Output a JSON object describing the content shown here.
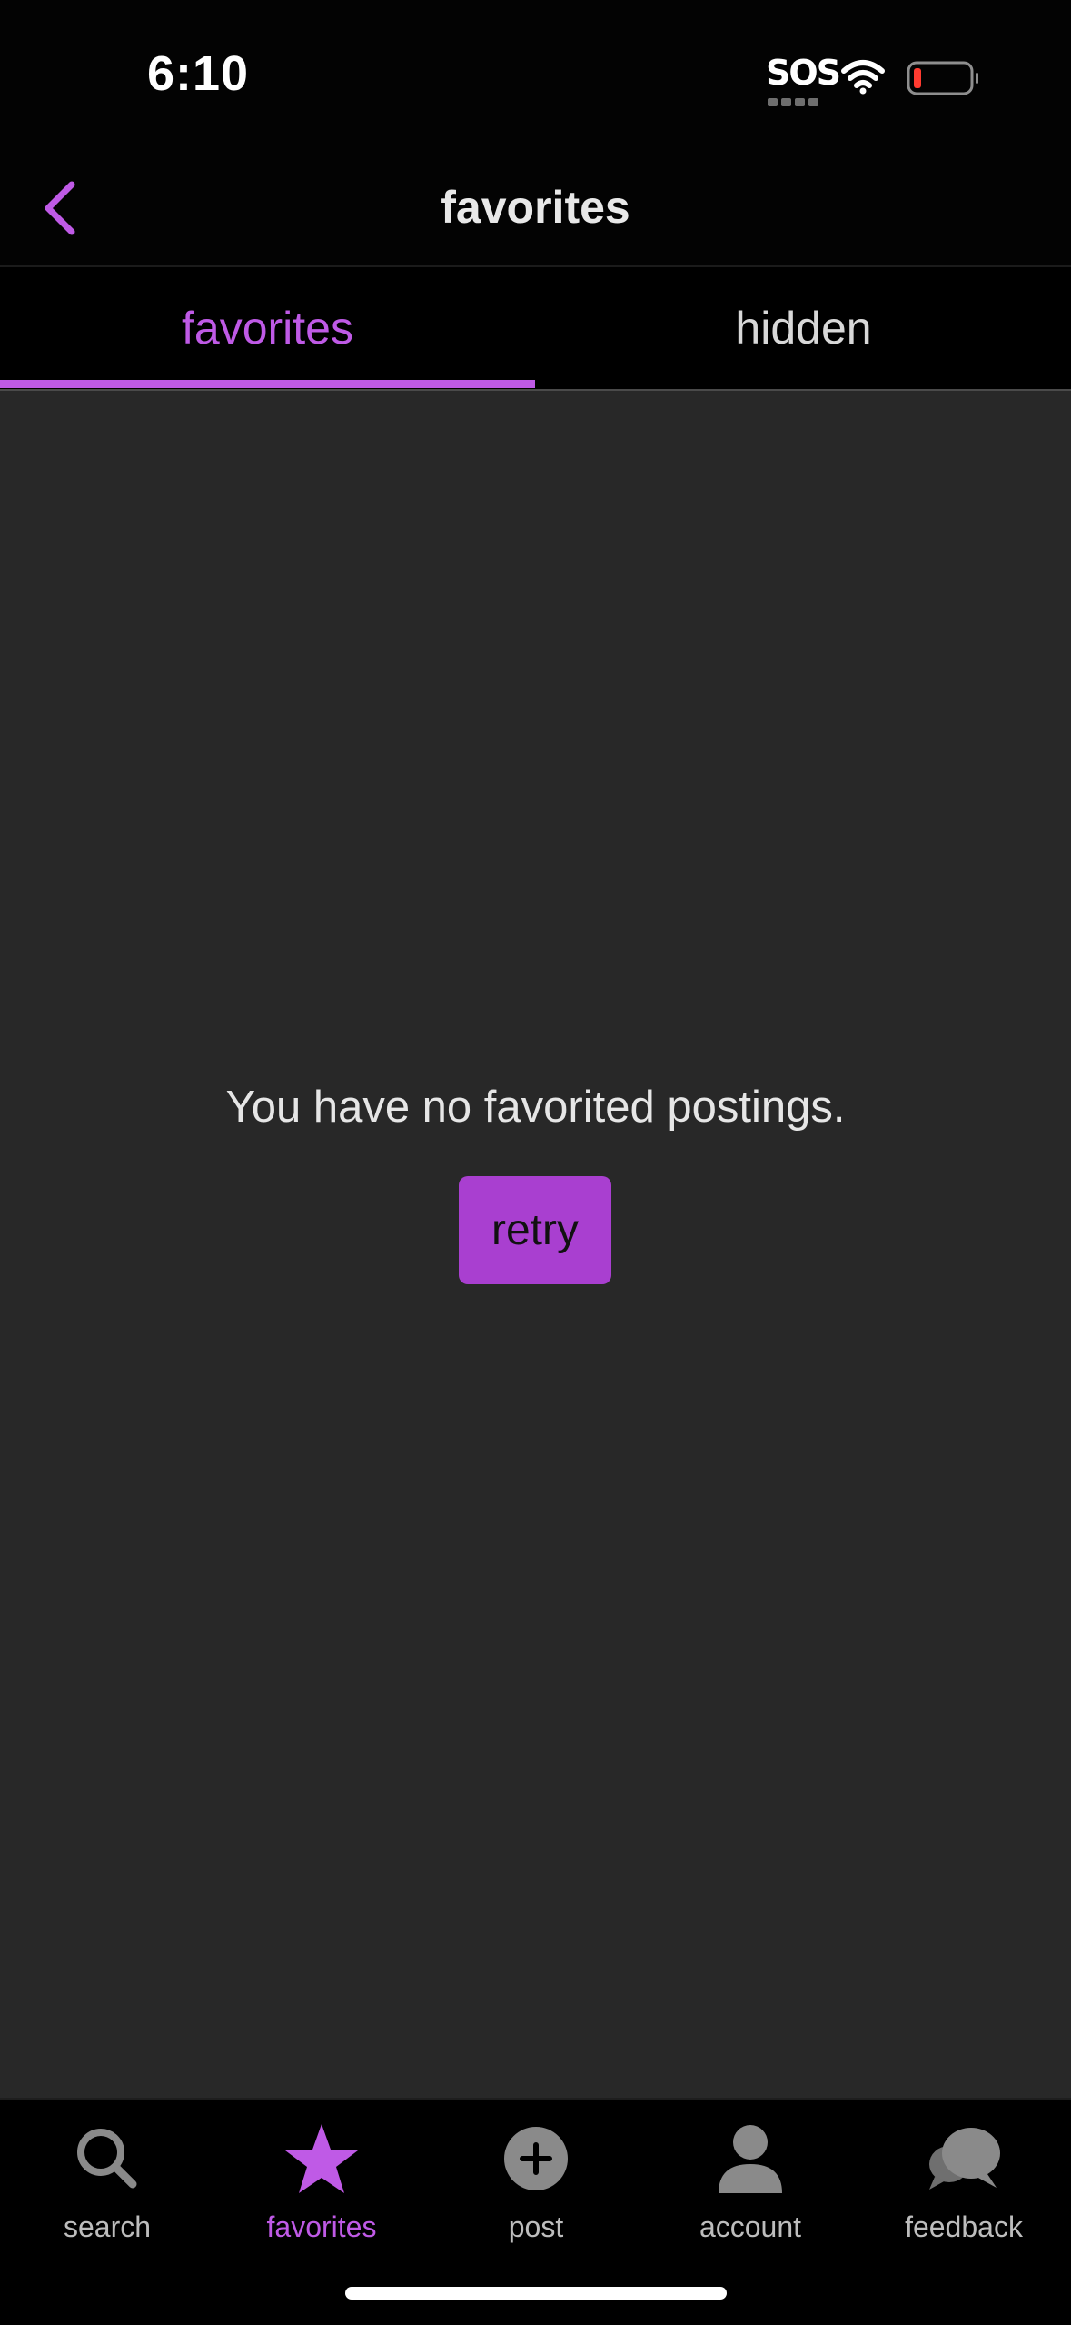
{
  "status_bar": {
    "time": "6:10",
    "sos": "SOS",
    "battery_color": "#ff3b30"
  },
  "header": {
    "title": "favorites",
    "back_icon": "chevron-left-icon"
  },
  "tabs": [
    {
      "label": "favorites",
      "active": true
    },
    {
      "label": "hidden",
      "active": false
    }
  ],
  "main": {
    "empty_message": "You have no favorited postings.",
    "retry_label": "retry"
  },
  "bottom_nav": {
    "items": [
      {
        "label": "search",
        "icon": "search-icon",
        "active": false
      },
      {
        "label": "favorites",
        "icon": "star-icon",
        "active": true
      },
      {
        "label": "post",
        "icon": "plus-circle-icon",
        "active": false
      },
      {
        "label": "account",
        "icon": "person-icon",
        "active": false
      },
      {
        "label": "feedback",
        "icon": "chat-bubbles-icon",
        "active": false
      }
    ]
  },
  "colors": {
    "accent": "#bf5ae6",
    "button": "#a93fd0",
    "background": "#282828",
    "bar": "#000000"
  }
}
